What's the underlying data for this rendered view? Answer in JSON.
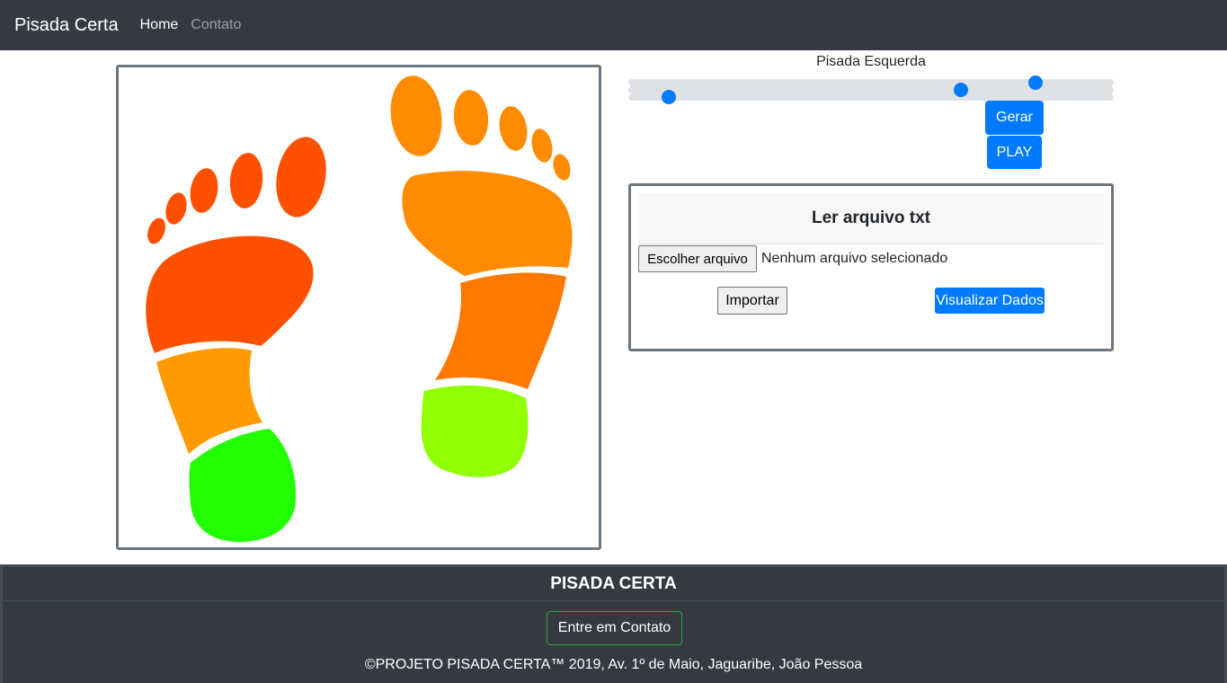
{
  "navbar": {
    "brand": "Pisada Certa",
    "links": [
      {
        "label": "Home",
        "active": true
      },
      {
        "label": "Contato",
        "active": false
      }
    ]
  },
  "foot_view": {
    "colors": {
      "left_toes": "#ff5000",
      "left_forefoot": "#ff5000",
      "left_midfoot": "#ff9a00",
      "left_heel": "#22ff00",
      "right_toes": "#ff8c00",
      "right_forefoot": "#ff8c00",
      "right_midfoot": "#ff7800",
      "right_heel": "#90ff00"
    }
  },
  "controls": {
    "title": "Pisada Esquerda",
    "sliders": [
      {
        "value": 0.85
      },
      {
        "value": 0.69
      },
      {
        "value": 0.07
      }
    ],
    "gerar_label": "Gerar",
    "play_label": "PLAY"
  },
  "reader": {
    "title": "Ler arquivo txt",
    "file_button_label": "Escolher arquivo",
    "file_status": "Nenhum arquivo selecionado",
    "import_label": "Importar",
    "view_label": "Visualizar Dados"
  },
  "footer": {
    "title": "PISADA CERTA",
    "contact_label": "Entre em Contato",
    "copyright": "©PROJETO PISADA CERTA™ 2019, Av. 1º de Maio, Jaguaribe, João Pessoa"
  },
  "colors": {
    "navbar": "#343a40",
    "primary": "#007bff",
    "success": "#28a745"
  }
}
